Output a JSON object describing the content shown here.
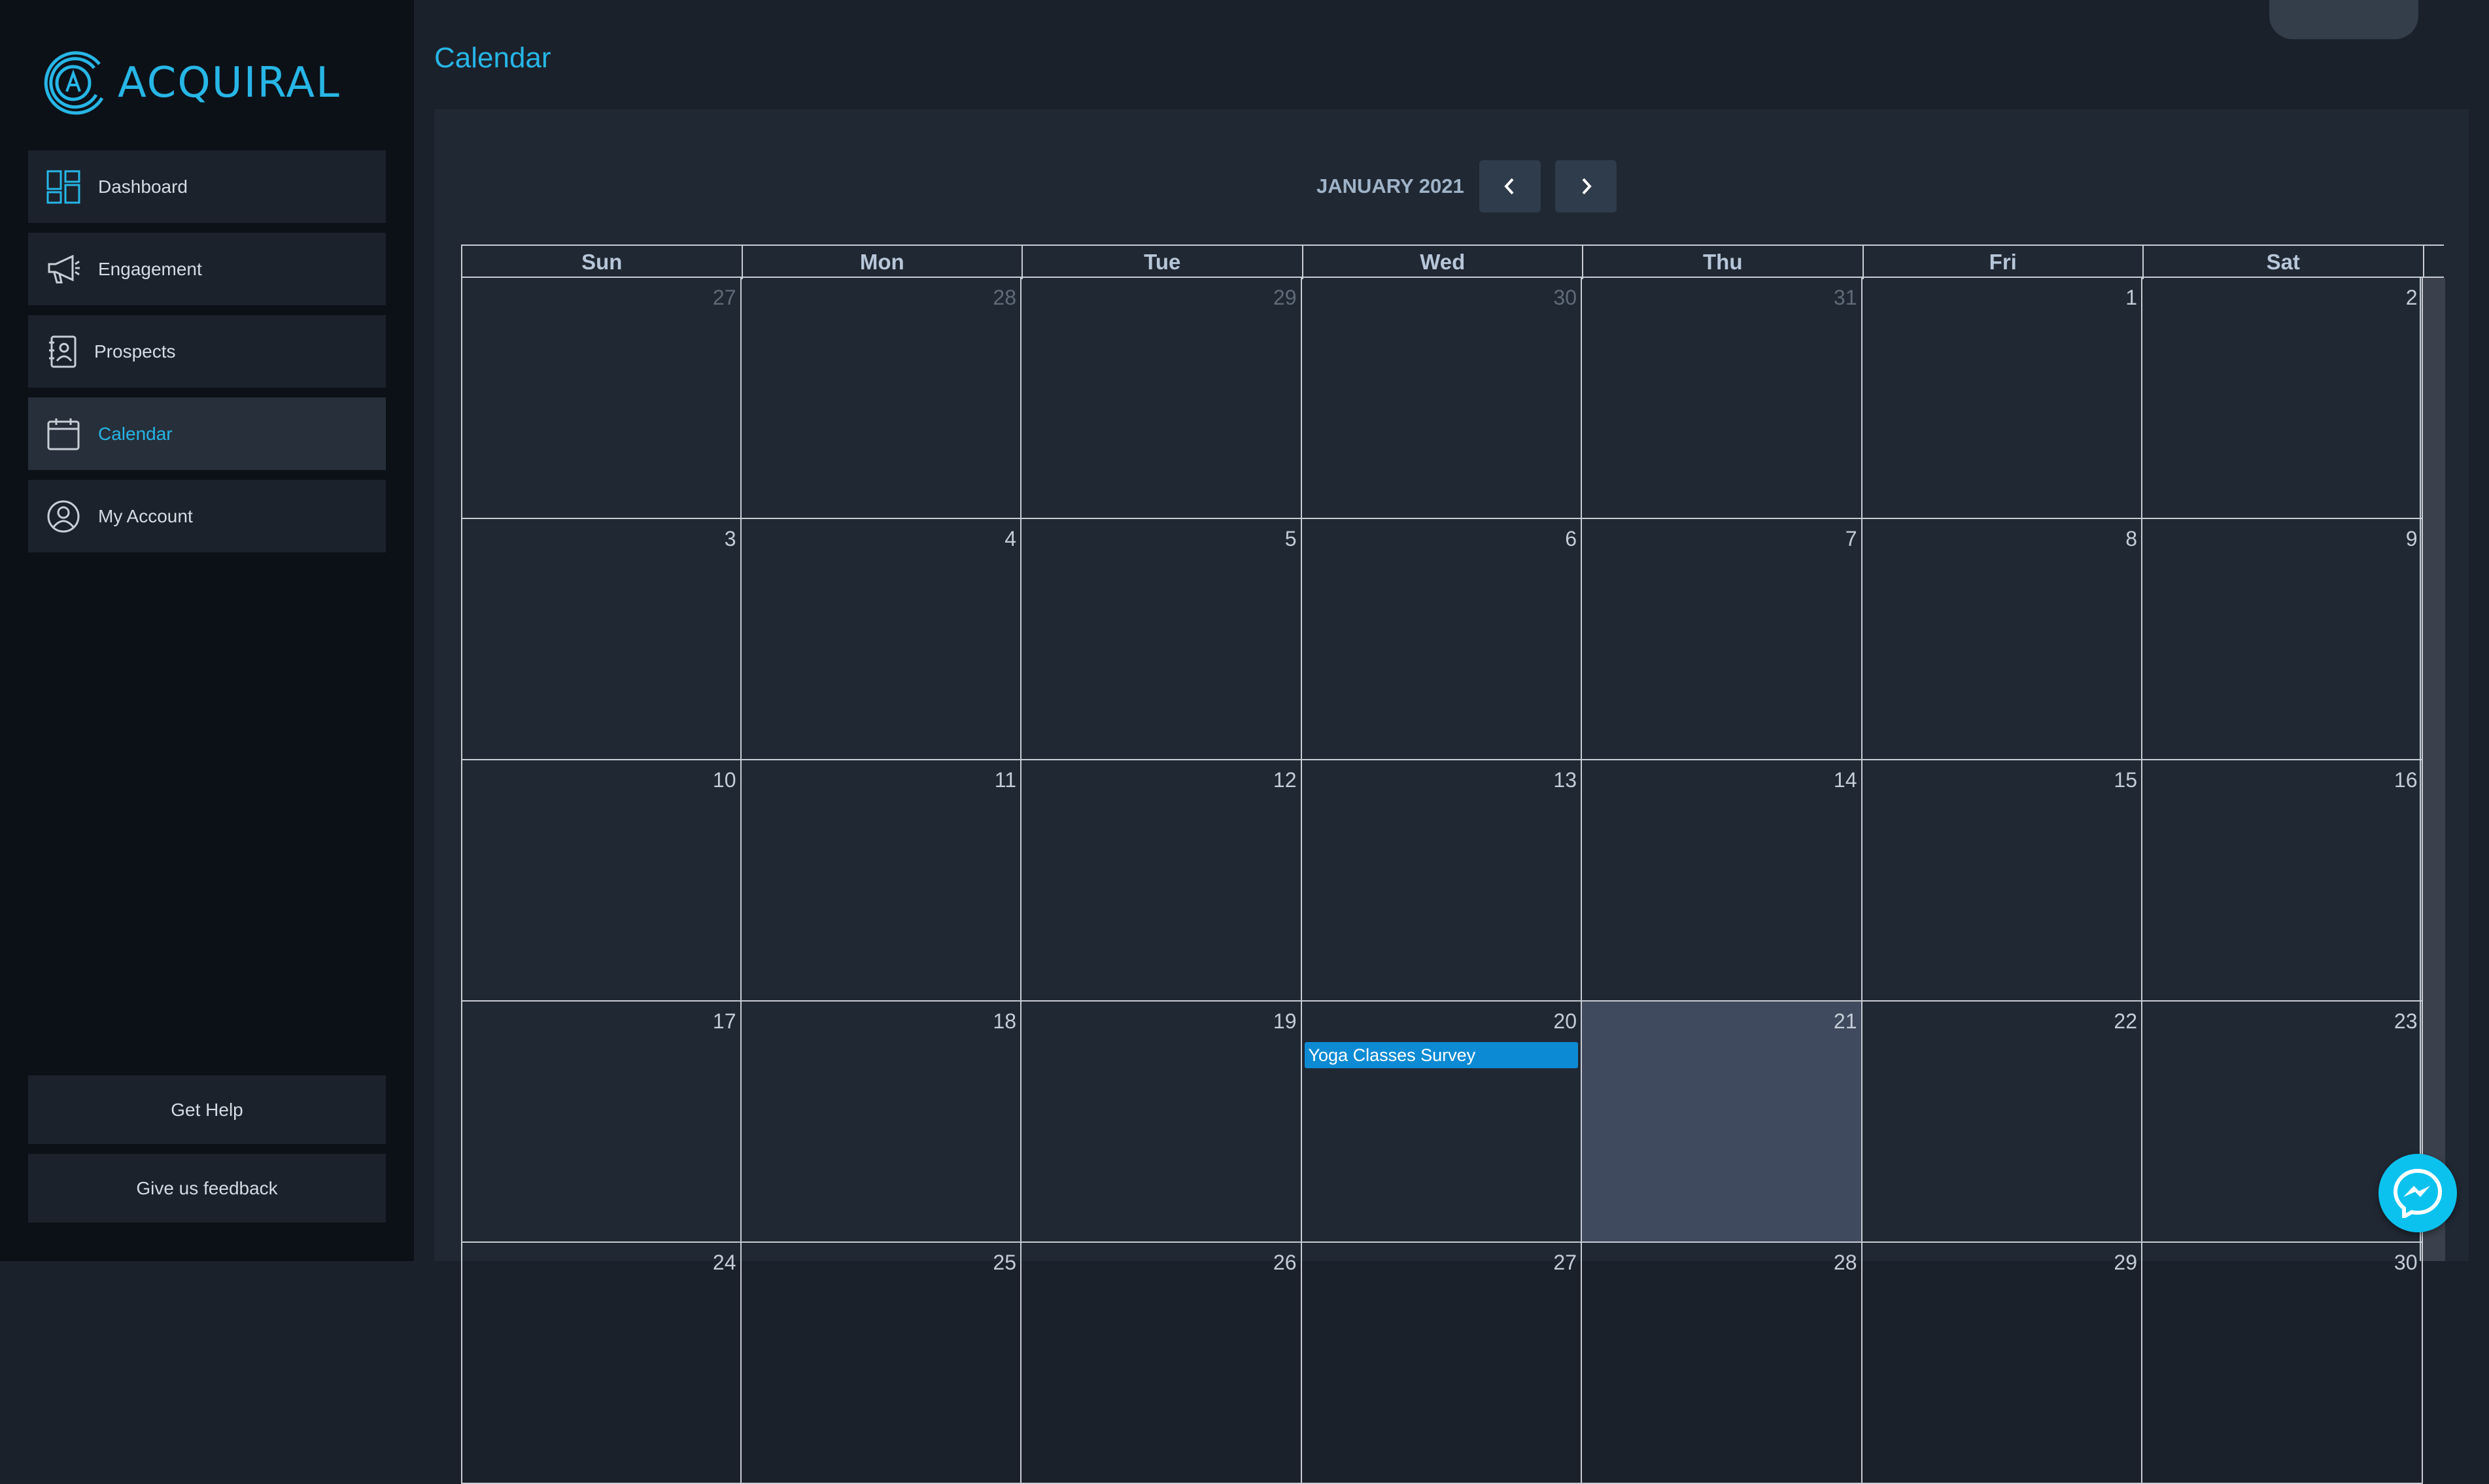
{
  "app": {
    "logo_text": "ACQUIRAL",
    "accent": "#27b6e6"
  },
  "sidebar": {
    "items": [
      {
        "label": "Dashboard",
        "icon": "dashboard-icon",
        "active": false
      },
      {
        "label": "Engagement",
        "icon": "megaphone-icon",
        "active": false
      },
      {
        "label": "Prospects",
        "icon": "contact-book-icon",
        "active": false
      },
      {
        "label": "Calendar",
        "icon": "calendar-icon",
        "active": true
      },
      {
        "label": "My Account",
        "icon": "user-circle-icon",
        "active": false
      }
    ],
    "help_label": "Get Help",
    "feedback_label": "Give us feedback"
  },
  "page": {
    "title": "Calendar"
  },
  "calendar": {
    "month_label": "JANUARY 2021",
    "weekdays": [
      "Sun",
      "Mon",
      "Tue",
      "Wed",
      "Thu",
      "Fri",
      "Sat"
    ],
    "weeks": [
      [
        {
          "d": "27",
          "other": true
        },
        {
          "d": "28",
          "other": true
        },
        {
          "d": "29",
          "other": true
        },
        {
          "d": "30",
          "other": true
        },
        {
          "d": "31",
          "other": true
        },
        {
          "d": "1"
        },
        {
          "d": "2"
        }
      ],
      [
        {
          "d": "3"
        },
        {
          "d": "4"
        },
        {
          "d": "5"
        },
        {
          "d": "6"
        },
        {
          "d": "7"
        },
        {
          "d": "8"
        },
        {
          "d": "9"
        }
      ],
      [
        {
          "d": "10"
        },
        {
          "d": "11"
        },
        {
          "d": "12"
        },
        {
          "d": "13"
        },
        {
          "d": "14"
        },
        {
          "d": "15"
        },
        {
          "d": "16"
        }
      ],
      [
        {
          "d": "17"
        },
        {
          "d": "18"
        },
        {
          "d": "19"
        },
        {
          "d": "20",
          "event": "Yoga Classes Survey"
        },
        {
          "d": "21",
          "highlight": true
        },
        {
          "d": "22"
        },
        {
          "d": "23"
        }
      ],
      [
        {
          "d": "24"
        },
        {
          "d": "25"
        },
        {
          "d": "26"
        },
        {
          "d": "27"
        },
        {
          "d": "28"
        },
        {
          "d": "29"
        },
        {
          "d": "30"
        }
      ]
    ],
    "event_color": "#0c8bd4",
    "highlight_color": "#404a5e"
  },
  "chat": {
    "icon": "messenger-icon",
    "color": "#0bc2ef"
  }
}
